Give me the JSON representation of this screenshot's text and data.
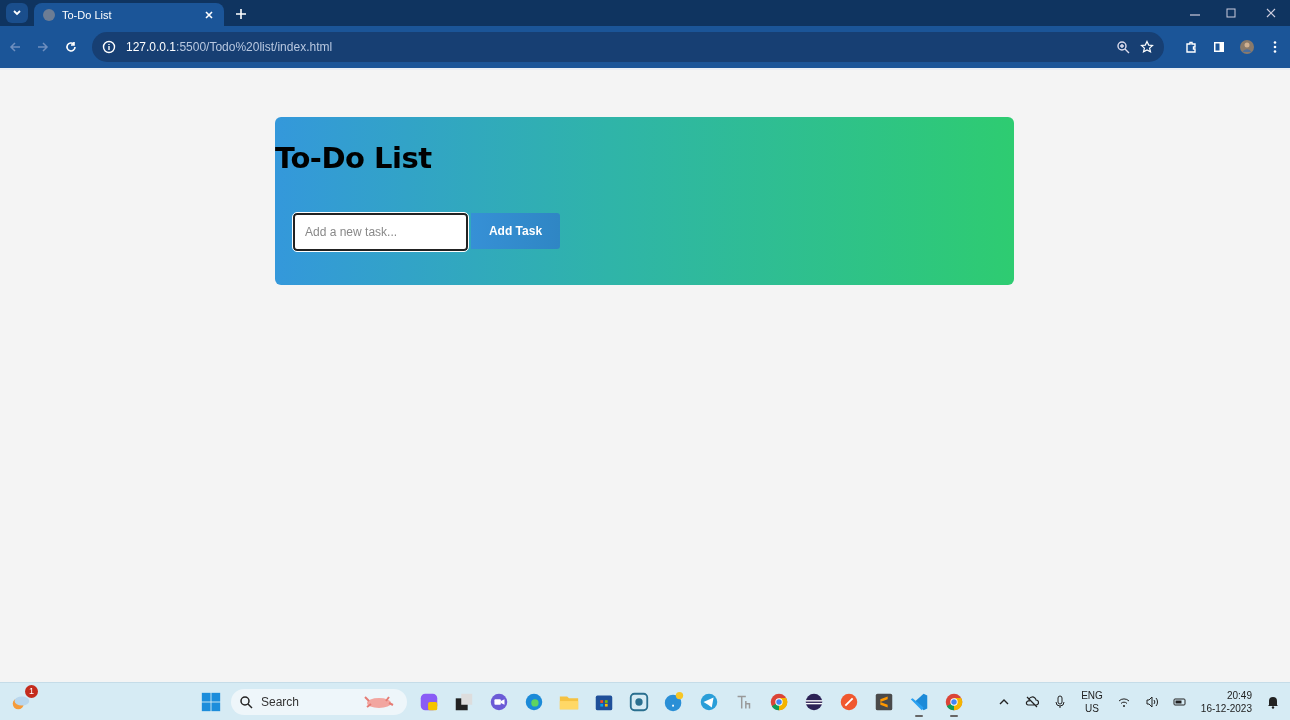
{
  "browser": {
    "tab": {
      "title": "To-Do List",
      "selected": true
    },
    "address": {
      "host": "127.0.0.1",
      "path": ":5500/Todo%20list/index.html"
    }
  },
  "card": {
    "title": "To-Do List",
    "input": {
      "placeholder": "Add a new task..."
    },
    "button": "Add Task"
  },
  "taskbar": {
    "widget_badge": "1",
    "search": {
      "placeholder": "Search"
    },
    "apps": [
      {
        "kind": "copilot",
        "running": false
      },
      {
        "kind": "taskview",
        "running": false
      },
      {
        "kind": "meet",
        "running": false
      },
      {
        "kind": "edge",
        "running": false
      },
      {
        "kind": "folder",
        "running": false
      },
      {
        "kind": "store",
        "running": false
      },
      {
        "kind": "snip",
        "running": false
      },
      {
        "kind": "help",
        "running": false
      },
      {
        "kind": "telegram",
        "running": false
      },
      {
        "kind": "font",
        "running": false
      },
      {
        "kind": "chrome",
        "running": false
      },
      {
        "kind": "eclipse",
        "running": false
      },
      {
        "kind": "swift",
        "running": false
      },
      {
        "kind": "sublime",
        "running": false
      },
      {
        "kind": "vscode",
        "running": true
      },
      {
        "kind": "chrome",
        "running": true
      }
    ],
    "language": [
      "ENG",
      "US"
    ],
    "time": "20:49",
    "date": "16-12-2023"
  }
}
